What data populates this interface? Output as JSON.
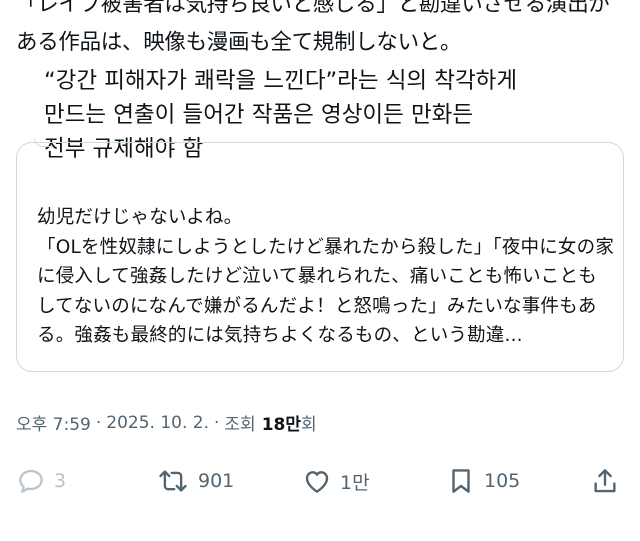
{
  "post": {
    "text": "「レイプ被害者は気持ち良いと感じる」と勘違いさせる演出がある作品は、映像も漫画も全て規制しないと。",
    "translation": "“강간 피해자가 쾌락을 느낀다”라는 식의 착각하게\n만드는 연출이 들어간 작품은 영상이든 만화든\n전부 규제해야 함"
  },
  "quote": {
    "text": "幼児だけじゃないよね。\n「OLを性奴隷にしようとしたけど暴れたから殺した」「夜中に女の家に侵入して強姦したけど泣いて暴れられた、痛いことも怖いこともしてないのになんで嫌がるんだよ！と怒鳴った」みたいな事件もある。強姦も最終的には気持ちよくなるもの、という勘違..."
  },
  "meta": {
    "time": "오후 7:59",
    "sep1": "·",
    "date": "2025. 10. 2.",
    "sep2": "·",
    "views_label": "조회",
    "views_number": "18만",
    "views_unit": "회"
  },
  "actions": {
    "replies": "3",
    "retweets": "901",
    "likes": "1만",
    "bookmarks": "105"
  },
  "icons": [
    "reply-icon",
    "retweet-icon",
    "like-icon",
    "bookmark-icon",
    "share-icon"
  ]
}
